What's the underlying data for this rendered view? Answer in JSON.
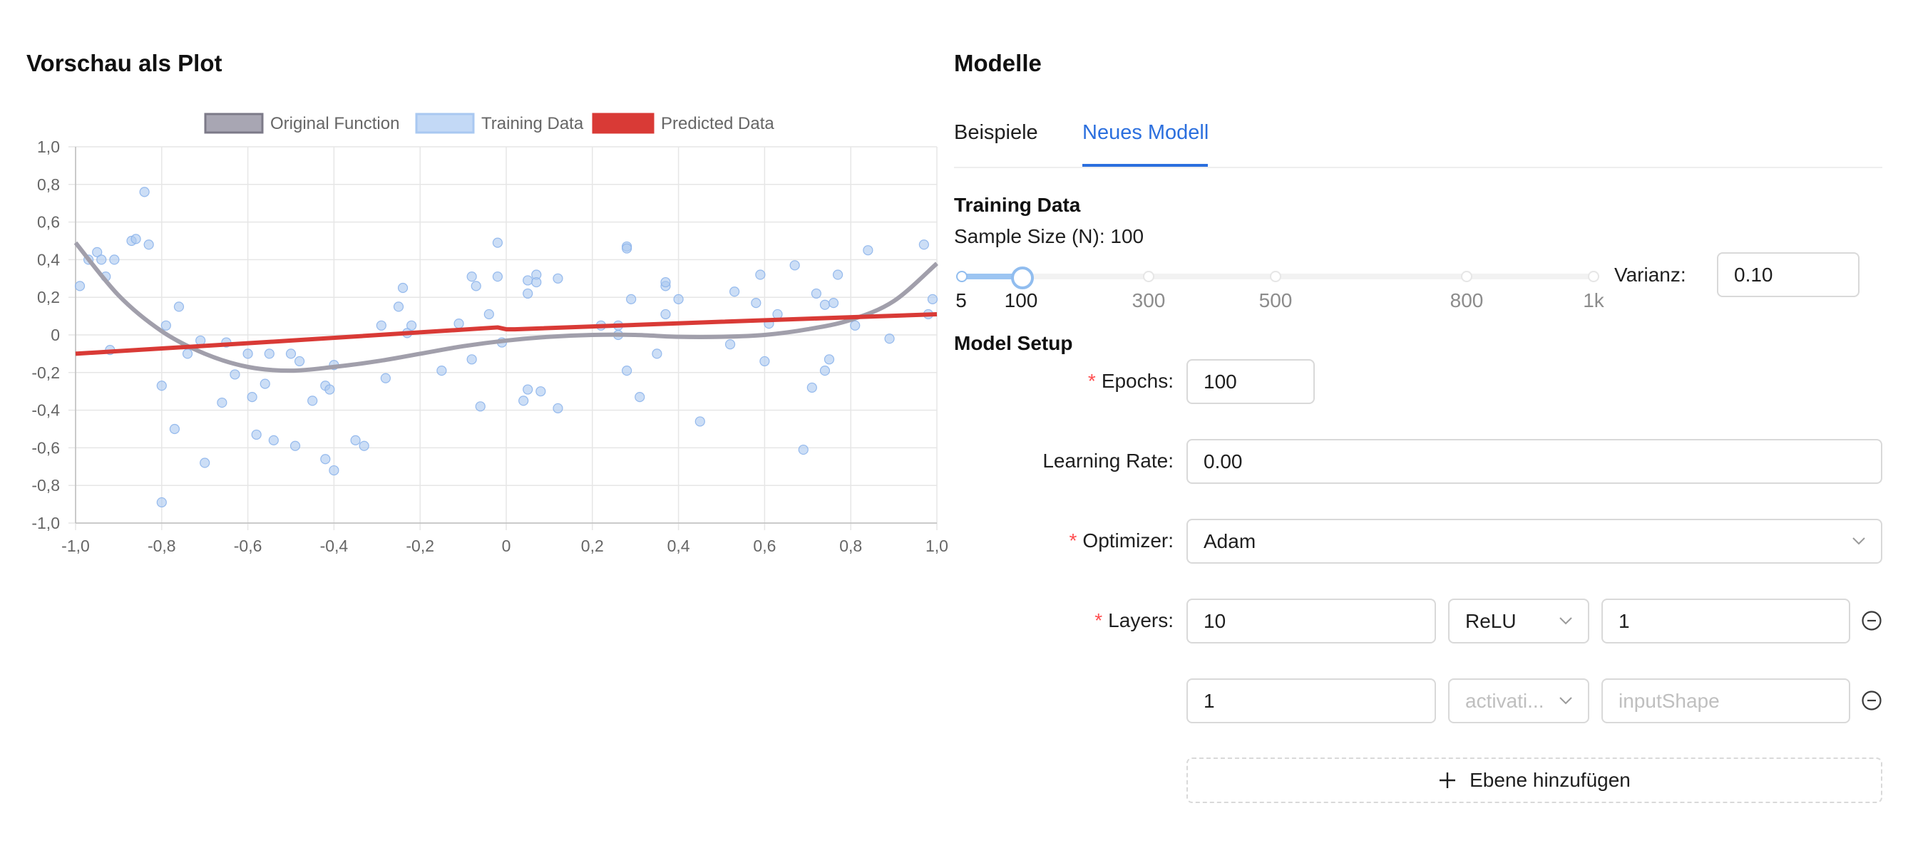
{
  "plot": {
    "title": "Vorschau als Plot"
  },
  "models": {
    "title": "Modelle"
  },
  "tabs": [
    {
      "label": "Beispiele",
      "active": false
    },
    {
      "label": "Neues Modell",
      "active": true
    }
  ],
  "training": {
    "heading": "Training Data",
    "sample_size_label": "Sample Size (N): 100",
    "sample_size": 100,
    "slider_marks": [
      "5",
      "100",
      "300",
      "500",
      "800",
      "1k"
    ],
    "varianz_label": "Varianz:",
    "varianz_value": "0.10"
  },
  "setup": {
    "heading": "Model Setup",
    "epochs_label": "Epochs",
    "epochs_value": "100",
    "lr_label": "Learning Rate",
    "lr_value": "0.00",
    "optimizer_label": "Optimizer",
    "optimizer_value": "Adam",
    "layers_label": "Layers",
    "layers": [
      {
        "units": "10",
        "activation": "ReLU",
        "activation_placeholder": "",
        "input_shape": "1",
        "input_placeholder": ""
      },
      {
        "units": "1",
        "activation": "",
        "activation_placeholder": "activati...",
        "input_shape": "",
        "input_placeholder": "inputShape"
      }
    ],
    "add_layer_label": "Ebene hinzufügen",
    "label_suffix": ":"
  },
  "icons": {
    "remove_layer": "minus-circle-icon",
    "add": "plus-icon",
    "dropdown": "chevron-down-icon"
  },
  "colors": {
    "accent": "#2b6fde",
    "original": "#a19fab",
    "training": "#c3d9f6",
    "predicted": "#d93a36"
  },
  "chart_data": {
    "type": "scatter",
    "legend": [
      "Original Function",
      "Training Data",
      "Predicted Data"
    ],
    "legend_position": "top",
    "xlim": [
      -1,
      1
    ],
    "ylim": [
      -1,
      1
    ],
    "x_ticks": [
      "-1,0",
      "-0,8",
      "-0,6",
      "-0,4",
      "-0,2",
      "0",
      "0,2",
      "0,4",
      "0,6",
      "0,8",
      "1,0"
    ],
    "y_ticks": [
      "1,0",
      "0,8",
      "0,6",
      "0,4",
      "0,2",
      "0",
      "-0,2",
      "-0,4",
      "-0,6",
      "-0,8",
      "-1,0"
    ],
    "grid": true,
    "series": [
      {
        "name": "Original Function",
        "type": "line",
        "x": [
          -1.0,
          -0.9,
          -0.8,
          -0.7,
          -0.6,
          -0.5,
          -0.4,
          -0.3,
          -0.2,
          -0.1,
          0.0,
          0.1,
          0.2,
          0.3,
          0.4,
          0.5,
          0.6,
          0.7,
          0.8,
          0.9,
          1.0
        ],
        "y": [
          0.49,
          0.21,
          0.02,
          -0.1,
          -0.17,
          -0.19,
          -0.17,
          -0.14,
          -0.1,
          -0.06,
          -0.03,
          -0.01,
          0.0,
          0.0,
          -0.01,
          -0.01,
          0.0,
          0.03,
          0.08,
          0.18,
          0.38
        ]
      },
      {
        "name": "Training Data",
        "type": "scatter",
        "points": [
          [
            -0.99,
            0.26
          ],
          [
            -0.97,
            0.4
          ],
          [
            -0.95,
            0.44
          ],
          [
            -0.94,
            0.4
          ],
          [
            -0.93,
            0.31
          ],
          [
            -0.92,
            -0.08
          ],
          [
            -0.91,
            0.4
          ],
          [
            -0.87,
            0.5
          ],
          [
            -0.86,
            0.51
          ],
          [
            -0.84,
            0.76
          ],
          [
            -0.83,
            0.48
          ],
          [
            -0.8,
            -0.27
          ],
          [
            -0.8,
            -0.89
          ],
          [
            -0.79,
            0.05
          ],
          [
            -0.77,
            -0.5
          ],
          [
            -0.76,
            0.15
          ],
          [
            -0.74,
            -0.1
          ],
          [
            -0.71,
            -0.03
          ],
          [
            -0.7,
            -0.68
          ],
          [
            -0.66,
            -0.36
          ],
          [
            -0.65,
            -0.04
          ],
          [
            -0.63,
            -0.21
          ],
          [
            -0.6,
            -0.1
          ],
          [
            -0.59,
            -0.33
          ],
          [
            -0.58,
            -0.53
          ],
          [
            -0.56,
            -0.26
          ],
          [
            -0.55,
            -0.1
          ],
          [
            -0.54,
            -0.56
          ],
          [
            -0.5,
            -0.1
          ],
          [
            -0.49,
            -0.59
          ],
          [
            -0.48,
            -0.14
          ],
          [
            -0.45,
            -0.35
          ],
          [
            -0.42,
            -0.66
          ],
          [
            -0.42,
            -0.27
          ],
          [
            -0.41,
            -0.29
          ],
          [
            -0.4,
            -0.16
          ],
          [
            -0.4,
            -0.72
          ],
          [
            -0.35,
            -0.56
          ],
          [
            -0.33,
            -0.59
          ],
          [
            -0.29,
            0.05
          ],
          [
            -0.28,
            -0.23
          ],
          [
            -0.25,
            0.15
          ],
          [
            -0.24,
            0.25
          ],
          [
            -0.23,
            0.01
          ],
          [
            -0.22,
            0.05
          ],
          [
            -0.15,
            -0.19
          ],
          [
            -0.11,
            0.06
          ],
          [
            -0.08,
            0.31
          ],
          [
            -0.08,
            -0.13
          ],
          [
            -0.07,
            0.26
          ],
          [
            -0.06,
            -0.38
          ],
          [
            -0.04,
            0.11
          ],
          [
            -0.02,
            0.49
          ],
          [
            -0.02,
            0.31
          ],
          [
            -0.01,
            -0.04
          ],
          [
            0.04,
            -0.35
          ],
          [
            0.05,
            -0.29
          ],
          [
            0.05,
            0.22
          ],
          [
            0.05,
            0.29
          ],
          [
            0.07,
            0.32
          ],
          [
            0.07,
            0.28
          ],
          [
            0.08,
            -0.3
          ],
          [
            0.12,
            0.3
          ],
          [
            0.12,
            -0.39
          ],
          [
            0.22,
            0.05
          ],
          [
            0.26,
            0.05
          ],
          [
            0.26,
            0.0
          ],
          [
            0.28,
            0.47
          ],
          [
            0.28,
            0.46
          ],
          [
            0.28,
            -0.19
          ],
          [
            0.29,
            0.19
          ],
          [
            0.31,
            -0.33
          ],
          [
            0.35,
            -0.1
          ],
          [
            0.37,
            0.26
          ],
          [
            0.37,
            0.28
          ],
          [
            0.37,
            0.11
          ],
          [
            0.4,
            0.19
          ],
          [
            0.45,
            -0.46
          ],
          [
            0.52,
            -0.05
          ],
          [
            0.53,
            0.23
          ],
          [
            0.58,
            0.17
          ],
          [
            0.59,
            0.32
          ],
          [
            0.6,
            -0.14
          ],
          [
            0.61,
            0.06
          ],
          [
            0.63,
            0.11
          ],
          [
            0.67,
            0.37
          ],
          [
            0.69,
            -0.61
          ],
          [
            0.71,
            -0.28
          ],
          [
            0.72,
            0.22
          ],
          [
            0.74,
            0.16
          ],
          [
            0.74,
            -0.19
          ],
          [
            0.75,
            -0.13
          ],
          [
            0.76,
            0.17
          ],
          [
            0.77,
            0.32
          ],
          [
            0.81,
            0.05
          ],
          [
            0.84,
            0.45
          ],
          [
            0.89,
            -0.02
          ],
          [
            0.97,
            0.48
          ],
          [
            0.98,
            0.11
          ],
          [
            0.99,
            0.19
          ]
        ]
      },
      {
        "name": "Predicted Data",
        "type": "line",
        "x": [
          -1.0,
          -0.5,
          -0.02,
          0.0,
          0.02,
          0.5,
          1.0
        ],
        "y": [
          -0.1,
          -0.03,
          0.04,
          0.03,
          0.03,
          0.07,
          0.11
        ]
      }
    ]
  }
}
